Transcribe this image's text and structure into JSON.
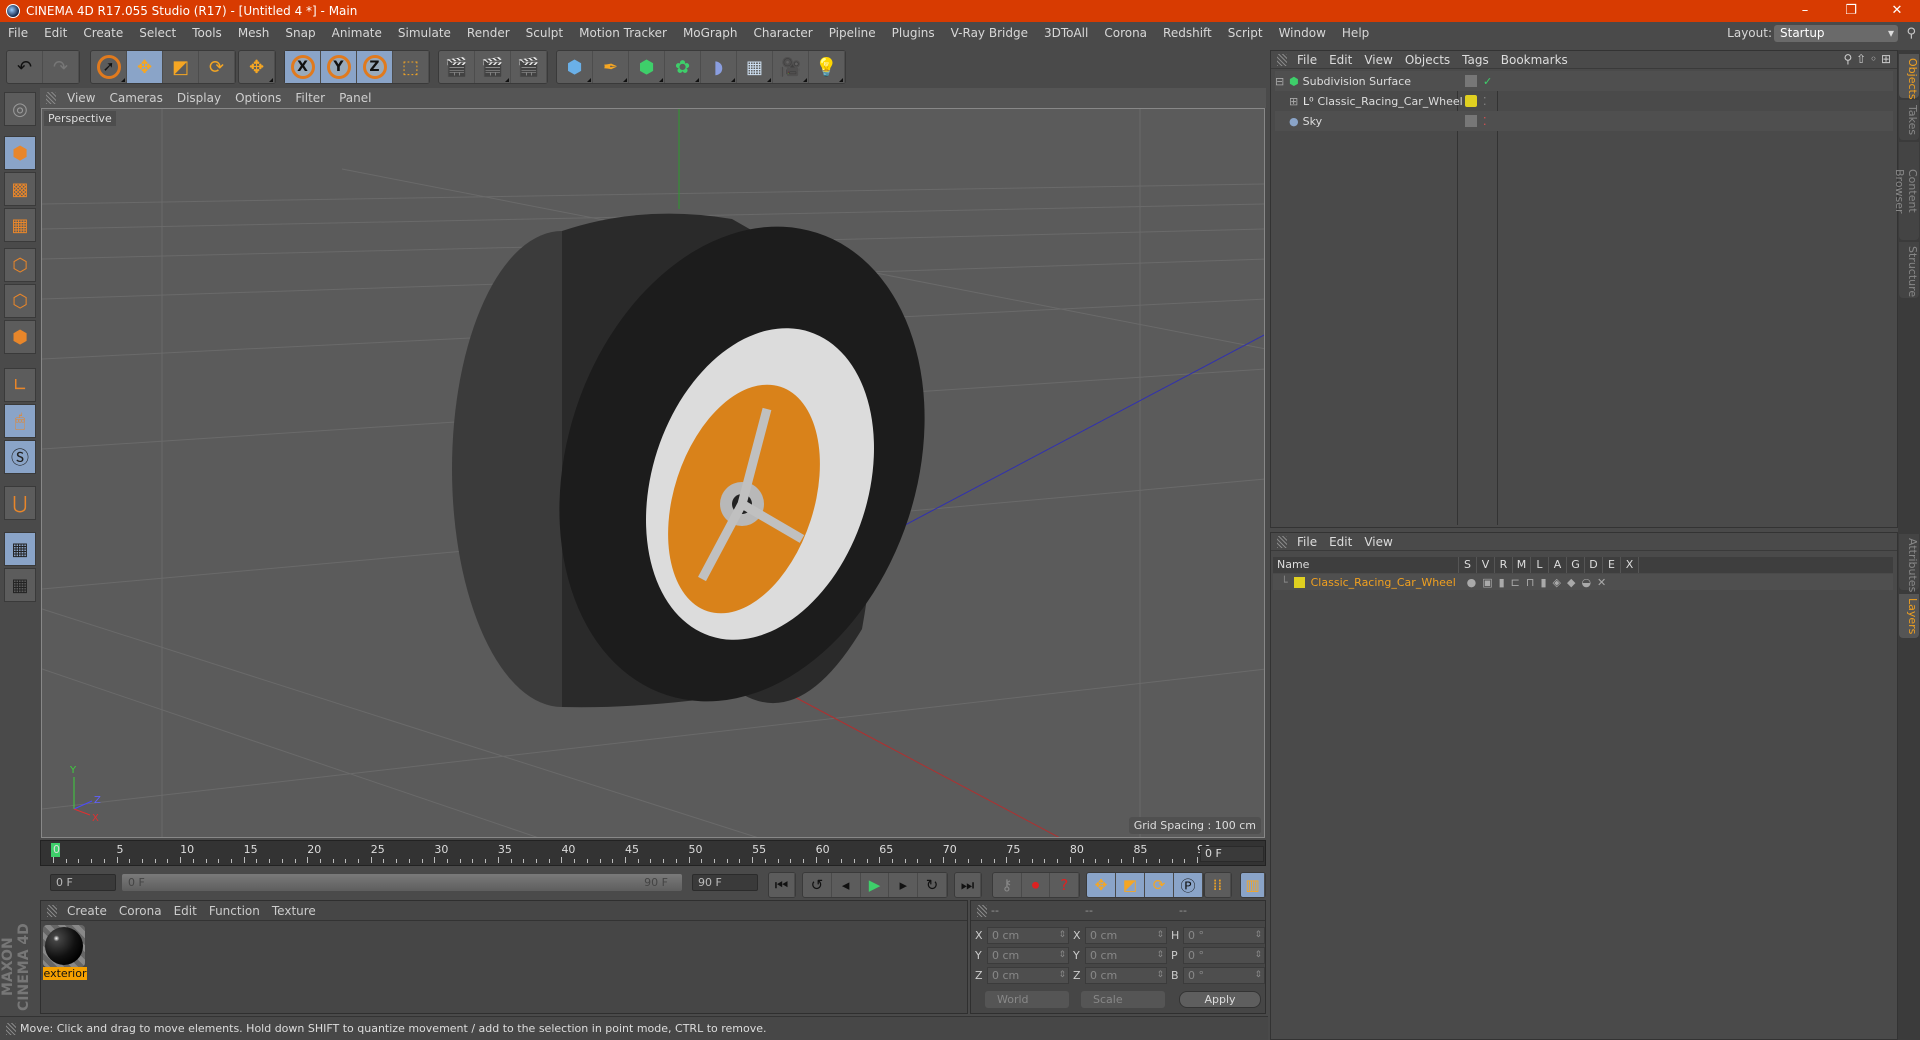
{
  "window": {
    "title": "CINEMA 4D R17.055 Studio (R17) - [Untitled 4 *] - Main",
    "controls": [
      "–",
      "❐",
      "✕"
    ]
  },
  "menubar": [
    "File",
    "Edit",
    "Create",
    "Select",
    "Tools",
    "Mesh",
    "Snap",
    "Animate",
    "Simulate",
    "Render",
    "Sculpt",
    "Motion Tracker",
    "MoGraph",
    "Character",
    "Pipeline",
    "Plugins",
    "V-Ray Bridge",
    "3DToAll",
    "Corona",
    "Redshift",
    "Script",
    "Window",
    "Help"
  ],
  "layout": {
    "label": "Layout:",
    "value": "Startup"
  },
  "toolbar": {
    "undo": "undo-icon",
    "redo": "redo-icon",
    "tools": [
      "live-selection",
      "move",
      "scale",
      "rotate",
      "recent-tool"
    ],
    "axes": [
      "X",
      "Y",
      "Z"
    ],
    "coord": "world-coordinate-system",
    "render": [
      "render-view",
      "render-picture-viewer",
      "edit-render-settings"
    ],
    "objects": [
      "cube",
      "pen",
      "subdivision-surface",
      "array",
      "bend-deformer",
      "floor",
      "camera",
      "light"
    ]
  },
  "viewport": {
    "menu": [
      "View",
      "Cameras",
      "Display",
      "Options",
      "Filter",
      "Panel"
    ],
    "camera_label": "Perspective",
    "grid_spacing": "Grid Spacing : 100 cm",
    "axis_labels": [
      "Y",
      "Z",
      "X"
    ]
  },
  "left_tools": [
    "make-editable",
    "model-mode",
    "texture-mode",
    "workplane-mode",
    "points-mode",
    "edges-mode",
    "polygons-mode",
    "axis-mode",
    "tweak-mode",
    "solo-mode",
    "snap",
    "workplane-lock",
    "workplane-align"
  ],
  "timeline": {
    "ticks": [
      "0",
      "5",
      "10",
      "15",
      "20",
      "25",
      "30",
      "35",
      "40",
      "45",
      "50",
      "55",
      "60",
      "65",
      "70",
      "75",
      "80",
      "85",
      "90"
    ],
    "current_frame": "0 F",
    "start_field": "0 F",
    "range_start": "0 F",
    "range_end": "90 F",
    "end_field": "90 F"
  },
  "material_manager": {
    "menu": [
      "Create",
      "Corona",
      "Edit",
      "Function",
      "Texture"
    ],
    "materials": [
      {
        "name": "exterior"
      }
    ]
  },
  "coordinates": {
    "headers": [
      "--",
      "--",
      "--"
    ],
    "rows": [
      {
        "a": "X",
        "v1": "0 cm",
        "b": "X",
        "v2": "0 cm",
        "c": "H",
        "v3": "0 °"
      },
      {
        "a": "Y",
        "v1": "0 cm",
        "b": "Y",
        "v2": "0 cm",
        "c": "P",
        "v3": "0 °"
      },
      {
        "a": "Z",
        "v1": "0 cm",
        "b": "Z",
        "v2": "0 cm",
        "c": "B",
        "v3": "0 °"
      }
    ],
    "mode": "World",
    "transform": "Scale",
    "apply": "Apply"
  },
  "status": "Move: Click and drag to move elements. Hold down SHIFT to quantize movement / add to the selection in point mode, CTRL to remove.",
  "brand": "MAXON CINEMA 4D",
  "object_manager": {
    "menu": [
      "File",
      "Edit",
      "View",
      "Objects",
      "Tags",
      "Bookmarks"
    ],
    "objects": [
      {
        "name": "Subdivision Surface",
        "color": "#3ecf6a",
        "check": "✓"
      },
      {
        "name": "Classic_Racing_Car_Wheel",
        "color": "#e0d020"
      },
      {
        "name": "Sky",
        "color": "#8aa4c8"
      }
    ]
  },
  "side_tabs": {
    "top": [
      "Objects",
      "Takes",
      "Content Browser",
      "Structure"
    ],
    "bottom": [
      "Attributes",
      "Layers"
    ]
  },
  "layer_manager": {
    "menu": [
      "File",
      "Edit",
      "View"
    ],
    "columns": [
      "Name",
      "S",
      "V",
      "R",
      "M",
      "L",
      "A",
      "G",
      "D",
      "E",
      "X"
    ],
    "layers": [
      {
        "name": "Classic_Racing_Car_Wheel",
        "color": "#e0d020"
      }
    ]
  }
}
